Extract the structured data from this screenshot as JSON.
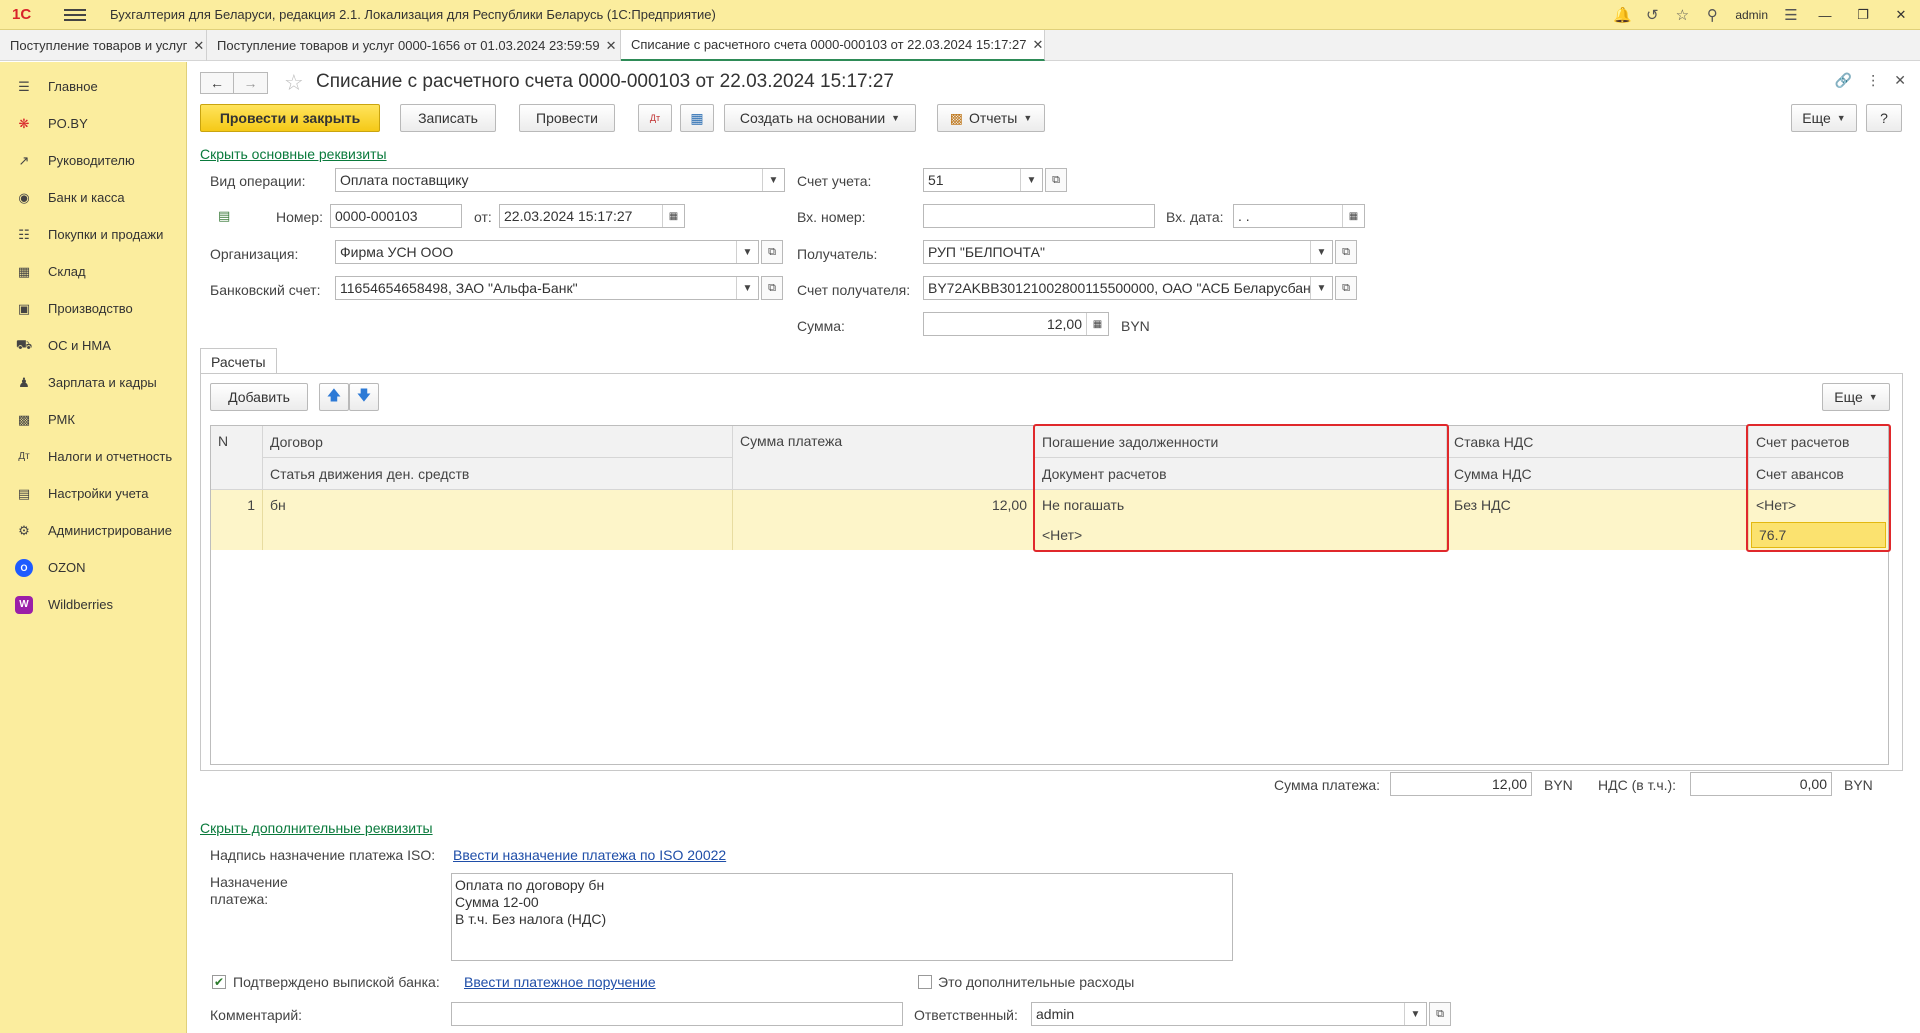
{
  "app": {
    "logo": "1С",
    "title": "Бухгалтерия для Беларуси, редакция 2.1. Локализация для Республики Беларусь   (1С:Предприятие)",
    "user": "admin"
  },
  "tabs": [
    {
      "label": "Поступление товаров и услуг"
    },
    {
      "label": "Поступление товаров и услуг 0000-1656 от 01.03.2024 23:59:59"
    },
    {
      "label": "Списание с расчетного счета 0000-000103 от 22.03.2024 15:17:27"
    }
  ],
  "sidebar": {
    "items": [
      {
        "label": "Главное",
        "icon": "menu-lines-icon"
      },
      {
        "label": "PO.BY",
        "icon": "poby-icon"
      },
      {
        "label": "Руководителю",
        "icon": "trend-icon"
      },
      {
        "label": "Банк и касса",
        "icon": "coin-icon"
      },
      {
        "label": "Покупки и продажи",
        "icon": "cart-icon"
      },
      {
        "label": "Склад",
        "icon": "warehouse-icon"
      },
      {
        "label": "Производство",
        "icon": "factory-icon"
      },
      {
        "label": "ОС и НМА",
        "icon": "truck-icon"
      },
      {
        "label": "Зарплата и кадры",
        "icon": "person-icon"
      },
      {
        "label": "РМК",
        "icon": "register-icon"
      },
      {
        "label": "Налоги и отчетность",
        "icon": "tax-icon"
      },
      {
        "label": "Настройки учета",
        "icon": "book-icon"
      },
      {
        "label": "Администрирование",
        "icon": "gear-icon"
      },
      {
        "label": "OZON",
        "icon": "ozon-icon"
      },
      {
        "label": "Wildberries",
        "icon": "wildberries-icon"
      }
    ]
  },
  "doc": {
    "title": "Списание с расчетного счета 0000-000103 от 22.03.2024 15:17:27"
  },
  "toolbar": {
    "post_close": "Провести и закрыть",
    "save": "Записать",
    "post": "Провести",
    "create_based": "Создать на основании",
    "reports": "Отчеты",
    "more": "Еще",
    "help": "?"
  },
  "form": {
    "hide_main_link": "Скрыть основные реквизиты",
    "operation_label": "Вид операции:",
    "operation_value": "Оплата поставщику",
    "number_label": "Номер:",
    "number_value": "0000-000103",
    "date_from_label": "от:",
    "date_value": "22.03.2024 15:17:27",
    "org_label": "Организация:",
    "org_value": "Фирма УСН ООО",
    "bank_account_label": "Банковский счет:",
    "bank_account_value": "11654654658498, ЗАО \"Альфа-Банк\"",
    "account_label": "Счет учета:",
    "account_value": "51",
    "in_number_label": "Вх. номер:",
    "in_number_value": "",
    "in_date_label": "Вх. дата:",
    "in_date_value": " .  .",
    "recipient_label": "Получатель:",
    "recipient_value": "РУП \"БЕЛПОЧТА\"",
    "recipient_account_label": "Счет получателя:",
    "recipient_account_value": "BY72AKBB30121002800115500000, ОАО \"АСБ Беларусбанк\"",
    "sum_label": "Сумма:",
    "sum_value": "12,00",
    "currency": "BYN"
  },
  "settlements": {
    "tab_label": "Расчеты",
    "add_button": "Добавить",
    "more": "Еще",
    "headers": {
      "n": "N",
      "contract": "Договор",
      "cash_flow": "Статья движения ден. средств",
      "payment_sum": "Сумма платежа",
      "debt_repayment": "Погашение задолженности",
      "settlement_doc": "Документ расчетов",
      "vat_rate": "Ставка НДС",
      "vat_sum": "Сумма НДС",
      "settlement_account": "Счет расчетов",
      "advance_account": "Счет авансов"
    },
    "rows": [
      {
        "n": "1",
        "contract": "бн",
        "cash_flow": "",
        "payment_sum": "12,00",
        "debt_repayment": "Не погашать",
        "settlement_doc": "<Нет>",
        "vat_rate": "Без НДС",
        "vat_sum": "",
        "settlement_account": "<Нет>",
        "advance_account": "76.7"
      }
    ],
    "footer": {
      "payment_sum_label": "Сумма платежа:",
      "payment_sum_value": "12,00",
      "currency": "BYN",
      "vat_label": "НДС (в т.ч.):",
      "vat_value": "0,00",
      "vat_currency": "BYN"
    },
    "highlight_color": "#e0282b"
  },
  "additional": {
    "hide_link": "Скрыть дополнительные реквизиты",
    "iso_label": "Надпись назначение платежа ISO:",
    "iso_link": "Ввести назначение платежа по ISO 20022",
    "purpose_label_1": "Назначение",
    "purpose_label_2": "платежа:",
    "purpose_lines": [
      "Оплата по договору бн",
      "Сумма 12-00",
      "В т.ч. Без налога (НДС)"
    ],
    "confirmed_label": "Подтверждено выпиской банка:",
    "confirmed_checked": true,
    "payment_order_link": "Ввести платежное поручение",
    "extra_expenses_label": "Это дополнительные расходы",
    "extra_expenses_checked": false,
    "comment_label": "Комментарий:",
    "comment_value": "",
    "responsible_label": "Ответственный:",
    "responsible_value": "admin"
  }
}
